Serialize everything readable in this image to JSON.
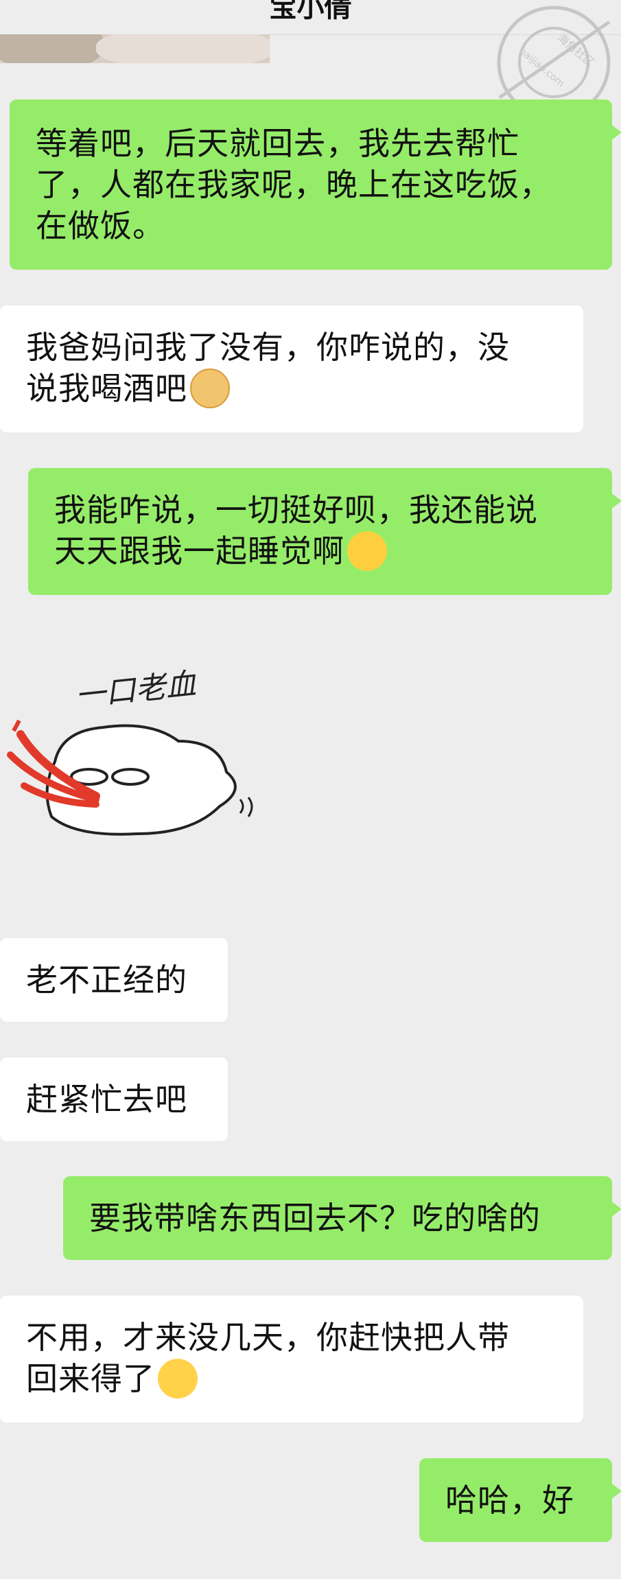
{
  "chat": {
    "title": "宝小倩"
  },
  "messages": [
    {
      "sender": "me",
      "lines": [
        "等着吧，后天就回去，我先去帮忙",
        "了，人都在我家呢，晚上在这吃饭，",
        "在做饭。"
      ]
    },
    {
      "sender": "other",
      "lines": [
        "我爸妈问我了没有，你咋说的，没",
        "说我喝酒吧"
      ],
      "emoji": "doge-emoji"
    },
    {
      "sender": "me",
      "lines": [
        "我能咋说，一切挺好呗，我还能说",
        "天天跟我一起睡觉啊"
      ],
      "emoji": "tears-of-joy-emoji"
    },
    {
      "sender": "other",
      "type": "sticker",
      "text": "一口老血"
    },
    {
      "sender": "other",
      "lines": [
        "老不正经的"
      ]
    },
    {
      "sender": "other",
      "lines": [
        "赶紧忙去吧"
      ]
    },
    {
      "sender": "me",
      "lines": [
        "要我带啥东西回去不？吃的啥的"
      ]
    },
    {
      "sender": "other",
      "lines": [
        "不用，才来没几天，你赶快把人带",
        "回来得了"
      ],
      "emoji": "eye-roll-emoji"
    },
    {
      "sender": "me",
      "lines": [
        "哈哈，好"
      ]
    }
  ],
  "watermark": {
    "text": "海角社区",
    "url_text": "haijiao.com"
  },
  "colors": {
    "background": "#ededed",
    "my_bubble": "#95ec69",
    "other_bubble": "#ffffff"
  }
}
